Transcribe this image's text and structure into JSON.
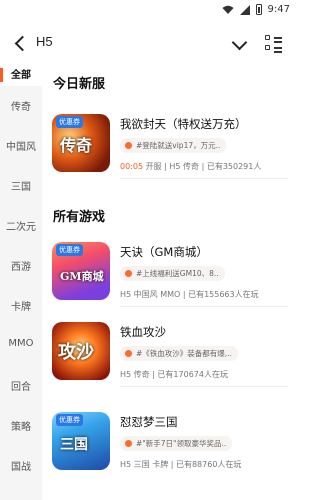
{
  "status_bar": {
    "time": "9:47"
  },
  "app_bar": {
    "title": "H5"
  },
  "sidebar": {
    "items": [
      {
        "label": "全部",
        "active": true
      },
      {
        "label": "传奇"
      },
      {
        "label": "中国风"
      },
      {
        "label": "三国"
      },
      {
        "label": "二次元"
      },
      {
        "label": "西游"
      },
      {
        "label": "卡牌"
      },
      {
        "label": "MMO"
      },
      {
        "label": "回合"
      },
      {
        "label": "策略"
      },
      {
        "label": "国战"
      }
    ]
  },
  "sections": {
    "today_title": "今日新服",
    "all_title": "所有游戏"
  },
  "today_games": [
    {
      "title": "我欲封天（特权送万充）",
      "promo": "#登陆就送vip17，万元..",
      "meta_accent": "00:05",
      "meta": " 开服 | H5 传奇 | 已有350291人",
      "badge": "优惠券",
      "thumb_text": "传奇"
    }
  ],
  "all_games": [
    {
      "title": "天诀（GM商城）",
      "promo": "#上线福利送GM10、8..",
      "meta": "H5 中国风 MMO | 已有155663人在玩",
      "badge": "优惠券",
      "thumb_text": "GM商城"
    },
    {
      "title": "铁血攻沙",
      "promo": "#《铁血攻沙》装备都有爆,..",
      "meta": "H5 传奇 | 已有170674人在玩",
      "badge": "",
      "thumb_text": "攻沙"
    },
    {
      "title": "怼怼梦三国",
      "promo": "#\"新手7日\"领取豪华奖品..",
      "meta": "H5 三国 卡牌 | 已有88760人在玩",
      "badge": "优惠券",
      "thumb_text": "三国"
    }
  ],
  "colors": {
    "accent": "#ff5a1f",
    "sidebar_bg": "#f5f5f5"
  },
  "icons": [
    "back-icon",
    "chevron-down-icon",
    "grid-list-icon",
    "wifi-icon",
    "signal-icon",
    "battery-icon"
  ]
}
